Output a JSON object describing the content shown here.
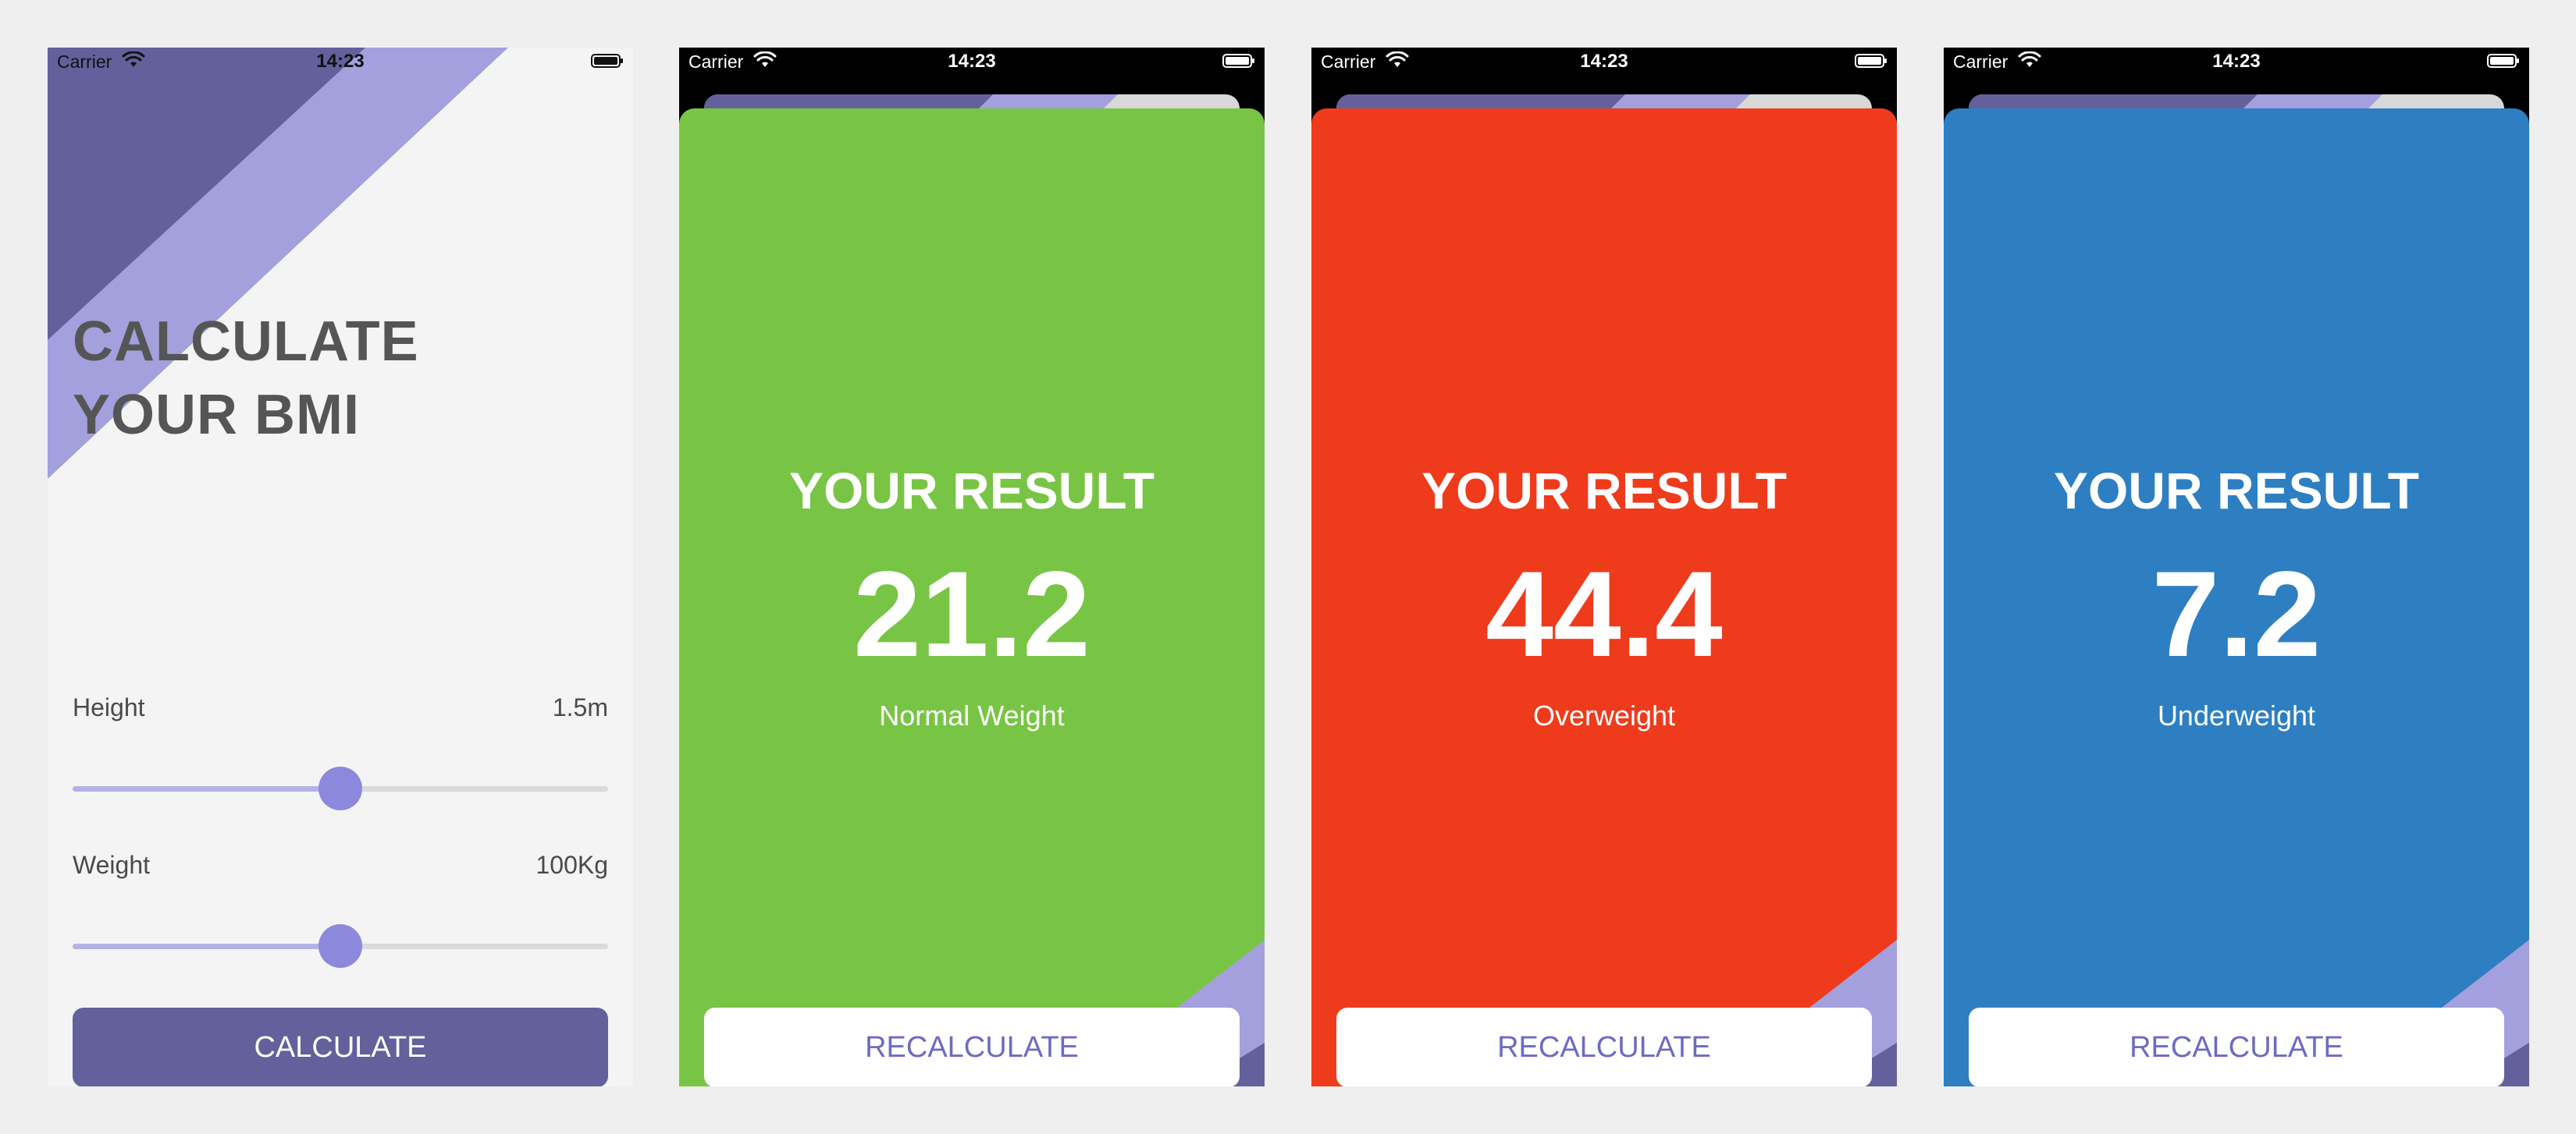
{
  "status_bar": {
    "carrier": "Carrier",
    "time": "14:23"
  },
  "calculator": {
    "title_line1": "CALCULATE",
    "title_line2": "YOUR BMI",
    "height": {
      "label": "Height",
      "value": "1.5m",
      "slider_level": 0.5
    },
    "weight": {
      "label": "Weight",
      "value": "100Kg",
      "slider_level": 0.5
    },
    "button_label": "CALCULATE"
  },
  "results": [
    {
      "title": "YOUR RESULT",
      "value": "21.2",
      "label": "Normal Weight",
      "color": "#78c545",
      "button_label": "RECALCULATE"
    },
    {
      "title": "YOUR RESULT",
      "value": "44.4",
      "label": "Overweight",
      "color": "#ee3b1c",
      "button_label": "RECALCULATE"
    },
    {
      "title": "YOUR RESULT",
      "value": "7.2",
      "label": "Underweight",
      "color": "#2d7fc2",
      "button_label": "RECALCULATE"
    }
  ],
  "colors": {
    "primary": "#64609b",
    "light_purple": "#a3a0dd",
    "slider_thumb": "#8c88dc",
    "button_text": "#6e6ac3"
  },
  "icons": [
    "wifi-icon",
    "battery-icon"
  ]
}
